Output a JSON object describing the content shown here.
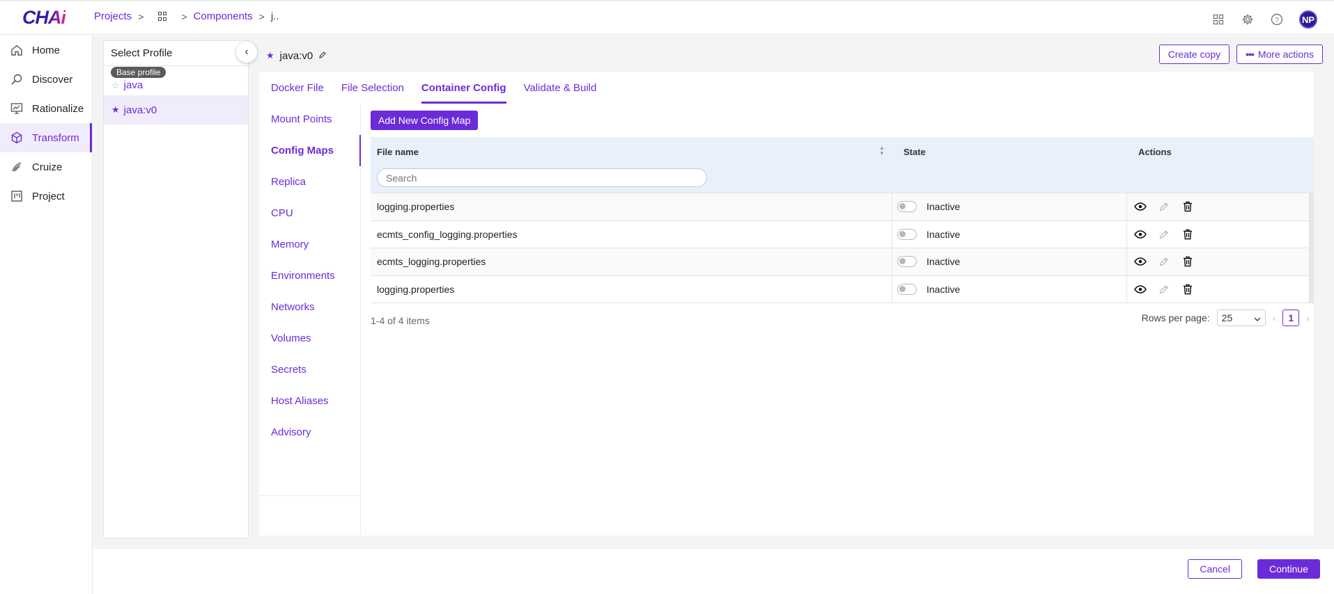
{
  "header": {
    "logo_main": "CH",
    "logo_accent": "Ai",
    "breadcrumb": [
      "Projects",
      "Components",
      "j.."
    ],
    "avatar_initials": "NP"
  },
  "nav": {
    "items": [
      {
        "label": "Home",
        "icon": "home-icon"
      },
      {
        "label": "Discover",
        "icon": "discover-icon"
      },
      {
        "label": "Rationalize",
        "icon": "rationalize-icon"
      },
      {
        "label": "Transform",
        "icon": "transform-icon",
        "active": true
      },
      {
        "label": "Cruize",
        "icon": "cruize-icon"
      },
      {
        "label": "Project",
        "icon": "project-icon"
      }
    ]
  },
  "profile": {
    "title": "Select Profile",
    "badge": "Base profile",
    "items": [
      {
        "label": "java",
        "starred": false
      },
      {
        "label": "java:v0",
        "starred": true,
        "selected": true
      }
    ]
  },
  "component": {
    "name": "java:v0",
    "create_copy": "Create copy",
    "more_actions": "More actions"
  },
  "tabs": [
    "Docker File",
    "File Selection",
    "Container Config",
    "Validate & Build"
  ],
  "active_tab": "Container Config",
  "subnav": [
    "Mount Points",
    "Config Maps",
    "Replica",
    "CPU",
    "Memory",
    "Environments",
    "Networks",
    "Volumes",
    "Secrets",
    "Host Aliases",
    "Advisory"
  ],
  "active_subnav": "Config Maps",
  "config_maps": {
    "add_button": "Add New Config Map",
    "columns": {
      "file": "File name",
      "state": "State",
      "actions": "Actions"
    },
    "search_placeholder": "Search",
    "rows": [
      {
        "file": "logging.properties",
        "state": "Inactive"
      },
      {
        "file": "ecmts_config_logging.properties",
        "state": "Inactive"
      },
      {
        "file": "ecmts_logging.properties",
        "state": "Inactive"
      },
      {
        "file": "logging.properties",
        "state": "Inactive"
      }
    ],
    "summary": "1-4 of 4 items",
    "rows_per_page_label": "Rows per page:",
    "rows_per_page": "25",
    "current_page": "1"
  },
  "footer": {
    "cancel": "Cancel",
    "continue": "Continue"
  },
  "colors": {
    "accent": "#6c2bd9",
    "header_row": "#e8f0fb",
    "content_bg": "#f4f4f5"
  }
}
